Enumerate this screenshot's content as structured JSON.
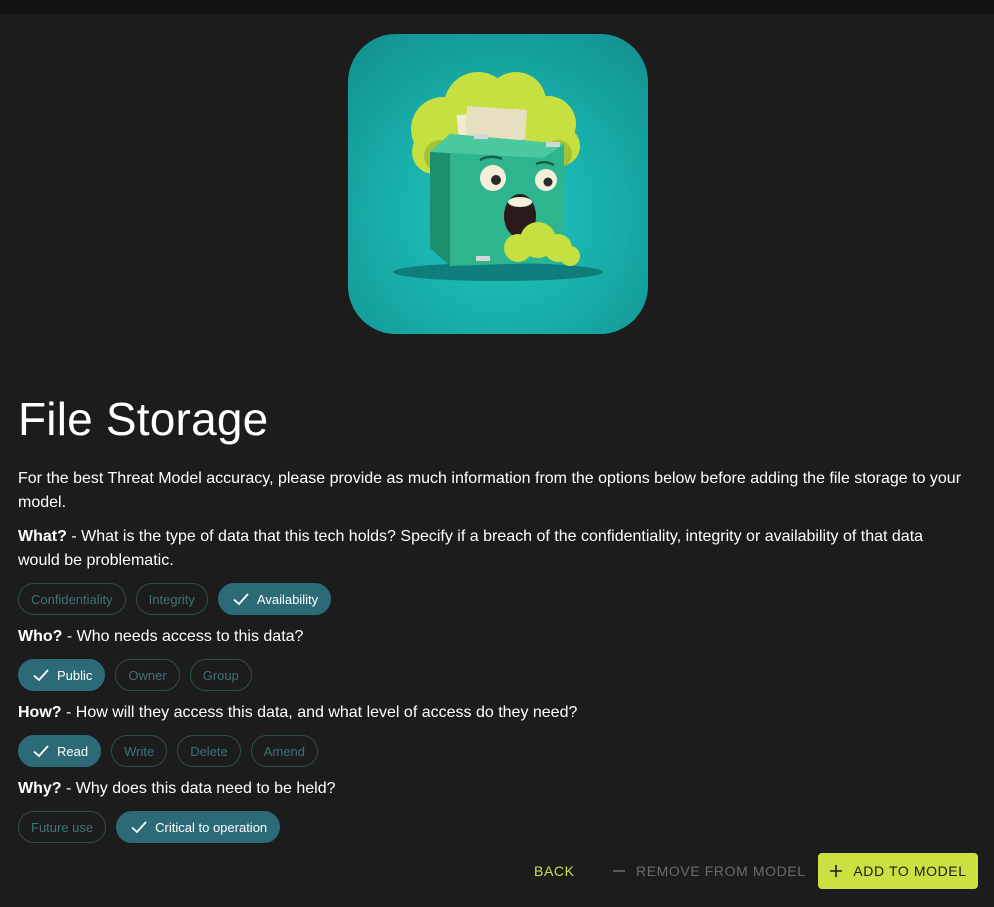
{
  "page": {
    "title": "File Storage",
    "intro": "For the best Threat Model accuracy, please provide as much information from the options below before adding the file storage to your model."
  },
  "questions": [
    {
      "label": "What?",
      "text": " - What is the type of data that this tech holds? Specify if a breach of the confidentiality, integrity or availability of that data would be problematic.",
      "chips": [
        {
          "label": "Confidentiality",
          "selected": false
        },
        {
          "label": "Integrity",
          "selected": false
        },
        {
          "label": "Availability",
          "selected": true
        }
      ]
    },
    {
      "label": "Who?",
      "text": " - Who needs access to this data?",
      "chips": [
        {
          "label": "Public",
          "selected": true
        },
        {
          "label": "Owner",
          "selected": false
        },
        {
          "label": "Group",
          "selected": false
        }
      ]
    },
    {
      "label": "How?",
      "text": " - How will they access this data, and what level of access do they need?",
      "chips": [
        {
          "label": "Read",
          "selected": true
        },
        {
          "label": "Write",
          "selected": false
        },
        {
          "label": "Delete",
          "selected": false
        },
        {
          "label": "Amend",
          "selected": false
        }
      ]
    },
    {
      "label": "Why?",
      "text": " - Why does this data need to be held?",
      "chips": [
        {
          "label": "Future use",
          "selected": false
        },
        {
          "label": "Critical to operation",
          "selected": true
        }
      ]
    }
  ],
  "actions": {
    "back": "BACK",
    "remove": "REMOVE FROM MODEL",
    "add": "ADD TO MODEL"
  },
  "icons": {
    "hero": "file-cabinet-cloud-illustration",
    "check": "check-icon",
    "minus": "minus-icon",
    "plus": "plus-icon"
  },
  "colors": {
    "background": "#1c1c1c",
    "chip_selected": "#2c6a78",
    "chip_outline": "#2f4c4f",
    "accent": "#cde042"
  }
}
